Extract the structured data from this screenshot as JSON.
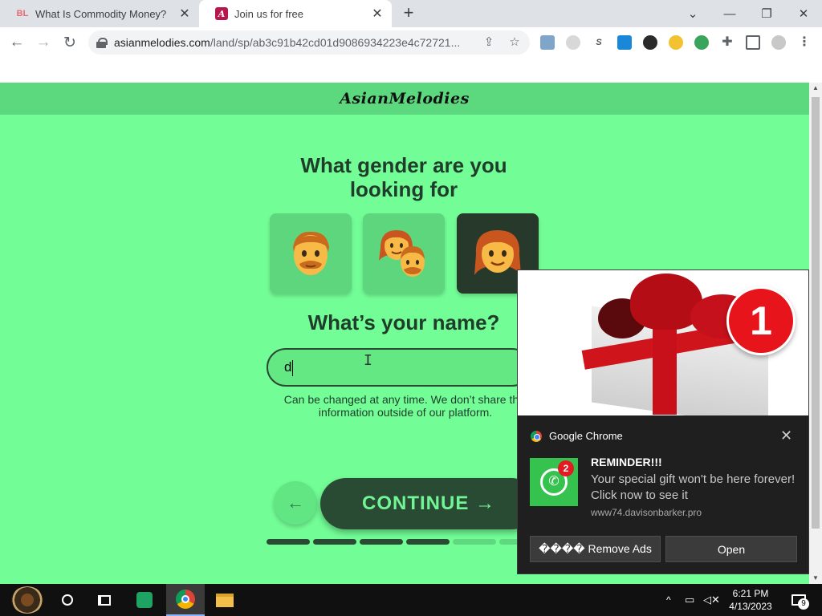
{
  "browser": {
    "tabs": [
      {
        "icon_text": "BL",
        "title": "What Is Commodity Money?",
        "close": "✕"
      },
      {
        "icon_text": "A",
        "title": "Join us for free",
        "close": "✕"
      }
    ],
    "new_tab": "+",
    "window_controls": {
      "tab_search": "⌄",
      "minimize": "—",
      "restore": "❐",
      "close": "✕"
    },
    "nav": {
      "back": "←",
      "forward": "→",
      "reload": "↻"
    },
    "address": {
      "host": "asianmelodies.com",
      "path": "/land/sp/ab3c91b42cd01d9086934223e4c72721..."
    },
    "extensions": [
      "ext-photo",
      "ext-circle",
      "ext-s",
      "ext-screen",
      "ext-cat",
      "ext-clock",
      "ext-globe",
      "extensions-puzzle",
      "side-panel",
      "profile",
      "menu"
    ]
  },
  "page": {
    "logo": "AsianMelodies",
    "question_gender": "What gender are you looking for",
    "gender_options": [
      "male",
      "both",
      "female"
    ],
    "selected_gender": "female",
    "question_name": "What’s your name?",
    "name_value": "d",
    "hint": "Can be changed at any time. We don’t share this information outside of our platform.",
    "back_label": "←",
    "continue_label": "CONTINUE →",
    "progress": {
      "total_steps": 6,
      "completed_steps": 4
    }
  },
  "notification": {
    "app": "Google Chrome",
    "close": "✕",
    "hero_badge": "1",
    "icon_badge": "2",
    "title": "REMINDER!!!",
    "body": "Your special gift won't be here forever! Click now to see it",
    "source": "www74.davisonbarker.pro",
    "button_remove": "���� Remove Ads",
    "button_open": "Open"
  },
  "taskbar": {
    "time": "6:21 PM",
    "date": "4/13/2023",
    "notification_count": "9",
    "tray_chevron": "^"
  },
  "colors": {
    "page_bg": "#73fd96",
    "header_bg": "#5cd97e",
    "primary_dark": "#2a4b33",
    "continue_text": "#72f595",
    "notif_bg": "#1f1f1f"
  }
}
